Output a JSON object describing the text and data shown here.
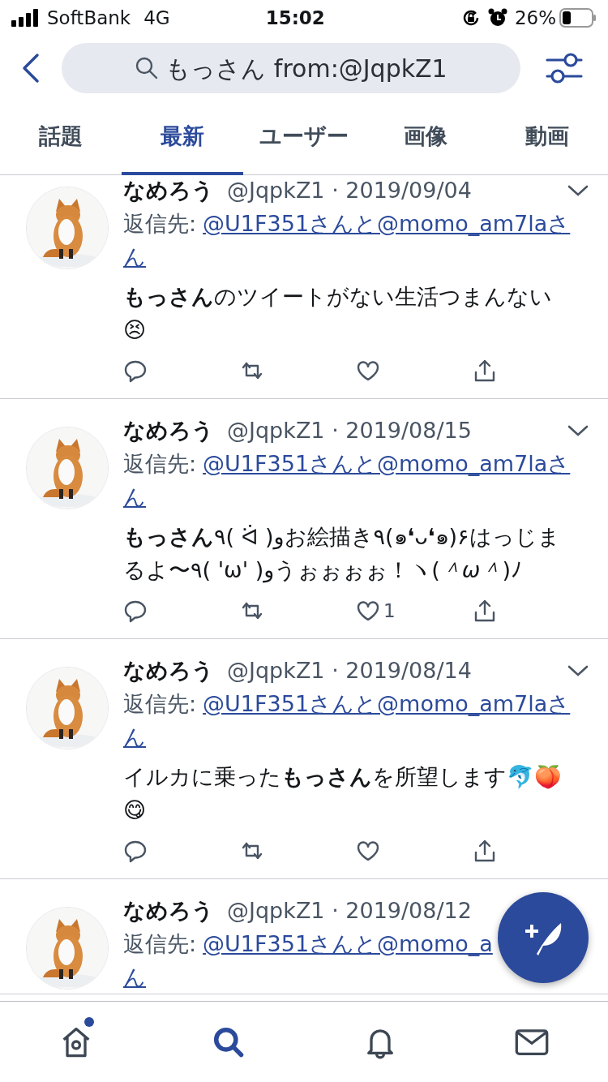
{
  "status_bar": {
    "carrier": "SoftBank",
    "network": "4G",
    "time": "15:02",
    "battery": "26%"
  },
  "search": {
    "value": "もっさん from:@JqpkZ1"
  },
  "tabs": [
    {
      "label": "話題",
      "selected": false
    },
    {
      "label": "最新",
      "selected": true
    },
    {
      "label": "ユーザー",
      "selected": false
    },
    {
      "label": "画像",
      "selected": false
    },
    {
      "label": "動画",
      "selected": false
    }
  ],
  "tweets": [
    {
      "name": "なめろう",
      "handle_date": "@JqpkZ1 · 2019/09/04",
      "caret": true,
      "reply_label": "返信先:",
      "reply_to_lines": [
        "@U1F351さんと@momo_am7laさ",
        "ん"
      ],
      "text": "**もっさん**のツイートがない生活つまんない😣"
    },
    {
      "name": "なめろう",
      "handle_date": "@JqpkZ1 · 2019/08/15",
      "caret": true,
      "reply_label": "返信先:",
      "reply_to_lines": [
        "@U1F351さんと@momo_am7laさ",
        "ん"
      ],
      "text": "**もっさん**٩( ᐛ )وお絵描き٩(๑❛ᴗ❛๑)۶はっじまるよ〜٩( 'ω' )وうぉぉぉぉ！ヽ(*＾ω＾*)ﾉ",
      "like_count": "1"
    },
    {
      "name": "なめろう",
      "handle_date": "@JqpkZ1 · 2019/08/14",
      "caret": true,
      "reply_label": "返信先:",
      "reply_to_lines": [
        "@U1F351さんと@momo_am7laさ",
        "ん"
      ],
      "text": "イルカに乗った**もっさん**を所望します🐬🍑😋"
    },
    {
      "name": "なめろう",
      "handle_date": "@JqpkZ1 · 2019/08/12",
      "reply_label": "返信先:",
      "reply_to_lines": [
        "@U1F351さんと@momo_a",
        "ん"
      ]
    }
  ],
  "bottom_nav": [
    {
      "kind": "home",
      "selected": false,
      "badge": true
    },
    {
      "kind": "search",
      "selected": true
    },
    {
      "kind": "notifications",
      "selected": false
    },
    {
      "kind": "messages",
      "selected": false
    }
  ]
}
